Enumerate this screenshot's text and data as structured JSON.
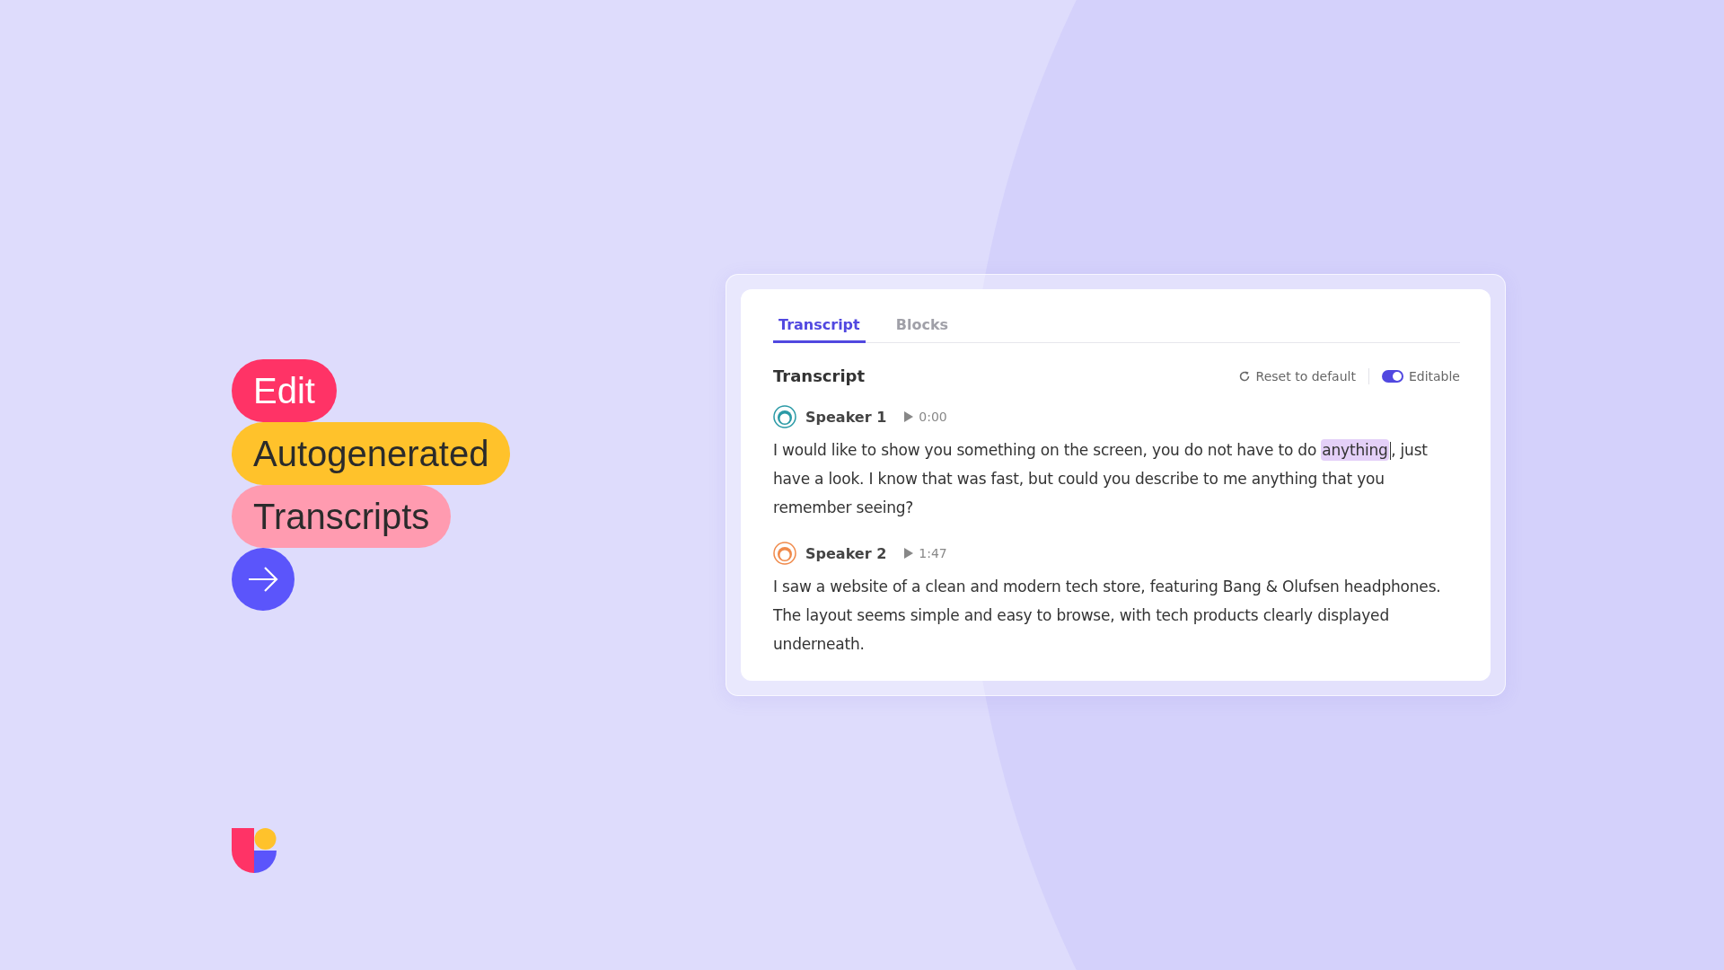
{
  "pills": [
    {
      "label": "Edit",
      "color": "#ff3366"
    },
    {
      "label": "Autogenerated",
      "color": "#ffc22b"
    },
    {
      "label": "Transcripts",
      "color": "#ff9bb0"
    }
  ],
  "tabs": [
    {
      "label": "Transcript",
      "selected": true
    },
    {
      "label": "Blocks",
      "selected": false
    }
  ],
  "panel": {
    "title": "Transcript",
    "reset": "Reset to default",
    "editable": {
      "label": "Editable",
      "on": true
    }
  },
  "entries": [
    {
      "speaker": "Speaker 1",
      "time": "0:00",
      "color": "#2a9aa6",
      "segments": [
        {
          "kind": "plain",
          "text": "I would like to show you something on the screen, you do not have to do "
        },
        {
          "kind": "highlight",
          "text": "anything",
          "cursor_after": true
        },
        {
          "kind": "plain",
          "text": ", just have a look. I know that was fast, but could you describe to me anything that you remember seeing?"
        }
      ]
    },
    {
      "speaker": "Speaker 2",
      "time": "1:47",
      "color": "#f08a4b",
      "segments": [
        {
          "kind": "plain",
          "text": "I saw a website of a clean and modern tech store, featuring Bang & Olufsen headphones. The layout seems simple and easy to browse, with tech products clearly displayed underneath."
        }
      ]
    }
  ]
}
